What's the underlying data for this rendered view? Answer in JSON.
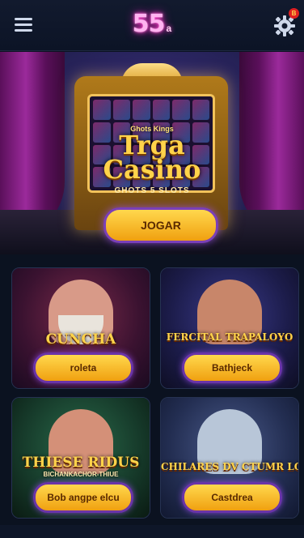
{
  "header": {
    "logo_text": "55",
    "logo_sub": "a",
    "notification_badge": "B",
    "icons": {
      "menu": "hamburger-menu-icon",
      "settings": "gear-icon"
    }
  },
  "hero": {
    "tag": "Ghots Kings",
    "title_line1": "Trga",
    "title_line2": "Casino",
    "subtitle": "GHOTS 5 SLOTS",
    "button_label": "JOGAR"
  },
  "games": [
    {
      "title": "CUNCHA",
      "subtitle": "",
      "button_label": "roleta"
    },
    {
      "title": "FERCITAL TRAPALOYO",
      "subtitle": "",
      "button_label": "Bathjeck"
    },
    {
      "title": "THIESE RIDUS",
      "subtitle": "BICHANKACHOR-THIUE",
      "button_label": "Bob angpe elcu"
    },
    {
      "title": "CHILARES DV CTUMR LOUSA",
      "subtitle": "",
      "button_label": "Castdrea"
    }
  ],
  "colors": {
    "background": "#0b1220",
    "accent_gold": "#ffd34a",
    "button_border": "#7a3fb8",
    "logo_pink": "#ff3cc8"
  }
}
